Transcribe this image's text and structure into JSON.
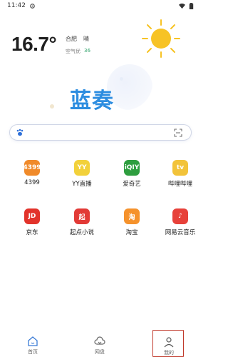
{
  "status_bar": {
    "time": "11:42",
    "icons": [
      "settings-icon",
      "wifi-icon",
      "battery-icon"
    ]
  },
  "weather": {
    "temperature": "16.7°",
    "city": "合肥",
    "condition": "晴",
    "air_quality_label": "空气优",
    "air_quality_value": "36",
    "icon": "sun-icon"
  },
  "logo": {
    "text": "蓝奏"
  },
  "search": {
    "placeholder": "",
    "left_icon": "paw-icon",
    "right_icon": "scan-icon"
  },
  "shortcuts": [
    {
      "label": "4399",
      "icon_text": "4399",
      "color": "#f08a2a",
      "icon": "game-4399-icon"
    },
    {
      "label": "YY直播",
      "icon_text": "YY",
      "color": "#f2d13b",
      "icon": "yy-live-icon"
    },
    {
      "label": "爱奇艺",
      "icon_text": "iQIY",
      "color": "#2e9e3f",
      "icon": "iqiyi-icon"
    },
    {
      "label": "哔哩哔哩",
      "icon_text": "tv",
      "color": "#f2c33a",
      "icon": "bilibili-icon"
    },
    {
      "label": "京东",
      "icon_text": "JD",
      "color": "#e2332b",
      "icon": "jd-icon"
    },
    {
      "label": "起点小说",
      "icon_text": "起",
      "color": "#e23a36",
      "icon": "qidian-icon"
    },
    {
      "label": "淘宝",
      "icon_text": "淘",
      "color": "#f5922c",
      "icon": "taobao-icon"
    },
    {
      "label": "网易云音乐",
      "icon_text": "♪",
      "color": "#e7413a",
      "icon": "netease-music-icon"
    }
  ],
  "tabs": [
    {
      "label": "首页",
      "icon": "home-icon",
      "active": false
    },
    {
      "label": "网盘",
      "icon": "cloud-icon",
      "active": false
    },
    {
      "label": "我的",
      "icon": "user-icon",
      "active": true
    }
  ],
  "colors": {
    "brand_blue": "#2d8de0",
    "accent_yellow": "#f7c325",
    "highlight_red": "#c0392b"
  }
}
